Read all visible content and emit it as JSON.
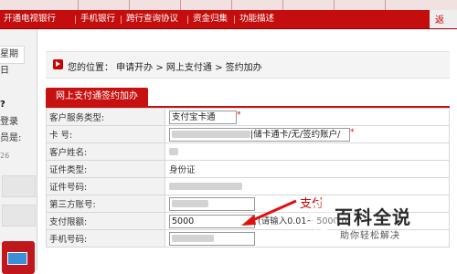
{
  "nav": {
    "items": [
      "开通电视银行",
      "手机银行",
      "跨行查询协议",
      "资金归集",
      "功能描述"
    ],
    "right_label": "返"
  },
  "sidebar": {
    "date_tab": "星期日",
    "line1": "?",
    "line2": "登录",
    "line3": "员是:",
    "line4": "26"
  },
  "breadcrumb": {
    "text": "您的位置： 申请开办 > 网上支付通 > 签约加办"
  },
  "panel": {
    "tab_label": "网上支付通签约加办"
  },
  "form": {
    "rows": [
      {
        "label": "客户服务类型:",
        "value": "支付宝卡通"
      },
      {
        "label": "卡 号:",
        "value": "|储卡通卡/无/签约账户/"
      },
      {
        "label": "客户姓名:",
        "value": ""
      },
      {
        "label": "证件类型:",
        "value": "身份证"
      },
      {
        "label": "证件号码:",
        "value": ""
      },
      {
        "label": "第三方账号:",
        "value": ""
      },
      {
        "label": "支付限额:",
        "value": "5000",
        "hint": "(请输入0.01~ 5000.0"
      },
      {
        "label": "手机号码:",
        "value": ""
      }
    ]
  },
  "annotation": {
    "label": "支付"
  },
  "watermark": {
    "title": "百科全说",
    "subtitle": "助你轻松解决"
  }
}
